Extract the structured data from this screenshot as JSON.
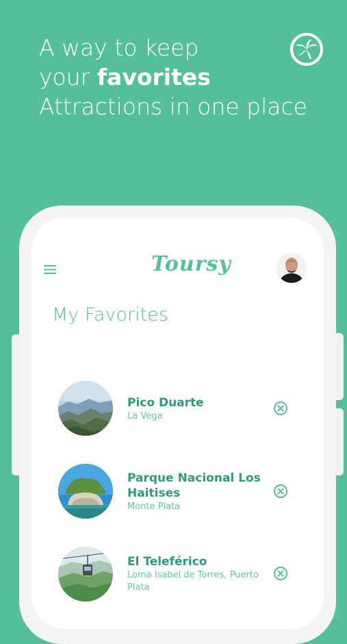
{
  "hero": {
    "line1": "A way to keep",
    "line2_prefix": "your ",
    "line2_bold": "favorites",
    "line3": "Attractions in one place"
  },
  "app": {
    "brand": "Toursy",
    "accent_color": "#55bf9b",
    "title_color": "#2f9a78",
    "menu_icon": "hamburger-menu-icon",
    "badge_icon": "palm-tree-icon",
    "section_title": "My Favorites"
  },
  "favorites": [
    {
      "name": "Pico Duarte",
      "location": "La Vega",
      "image": "mountain-landscape"
    },
    {
      "name": "Parque Nacional Los Haitises",
      "location": "Monte Plata",
      "image": "rock-island"
    },
    {
      "name": "El Teleférico",
      "location": "Loma Isabel de Torres, Puerto Plata",
      "image": "cable-car"
    }
  ]
}
